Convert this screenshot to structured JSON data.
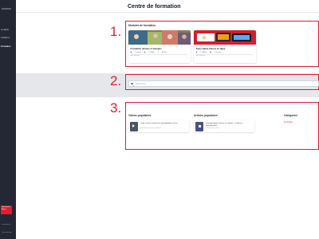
{
  "sidebar": {
    "items": [
      {
        "label": "ue Alpha"
      },
      {
        "label": "endations"
      },
      {
        "label": "Formation"
      }
    ],
    "promo": {
      "line1": "Experience",
      "line2": "Alpha"
    },
    "bottom": {
      "line1": "Paramètres",
      "line2": "Déconnexion"
    }
  },
  "header": {
    "title": "Centre de formation"
  },
  "annotations": {
    "one": "1.",
    "two": "2.",
    "three": "3."
  },
  "modules": {
    "title": "Modules de formation",
    "cards": [
      {
        "title": "Formation Jeunes et Campus",
        "meta": [
          "1 Leçon",
          "1 Vidéo",
          "46 Pro"
        ],
        "status": "Non démarré"
      },
      {
        "title": "Tutos Alpha Classe en ligne",
        "meta": [
          "7 Vidéos",
          "2 Leçons"
        ],
        "status": "Non démarré"
      }
    ]
  },
  "search": {
    "placeholder": "Rechercher"
  },
  "popular": {
    "videos_title": "Vidéos populaires",
    "articles_title": "Articles populaires",
    "categories_title": "Catégories",
    "video_item": {
      "title": "Projet Virtual Practices En Meeting Alpha Classe",
      "sub": "Formation des jeunes et campus"
    },
    "article_item": {
      "title": "Formation Alpha Jeunes et Campus : Centre de positionnement",
      "sub": "Formation des jeunes"
    },
    "category_link": "Formation"
  },
  "colors": {
    "accent": "#e11d2e",
    "sidebar": "#232834"
  },
  "icons": [
    "search-icon",
    "play-icon",
    "document-icon",
    "calendar-icon",
    "video-icon",
    "clock-icon"
  ]
}
